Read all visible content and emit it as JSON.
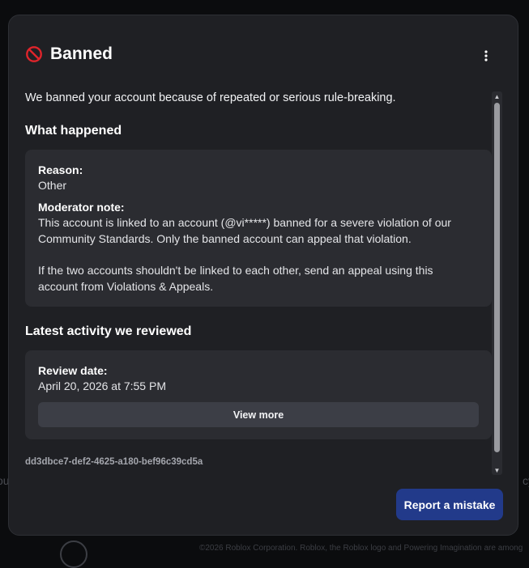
{
  "background": {
    "left_text": "ou",
    "right_text": "cy",
    "footer_text": "©2026 Roblox Corporation. Roblox, the Roblox logo and Powering Imagination are among"
  },
  "modal": {
    "title": "Banned",
    "icon": "ban-icon",
    "menu_icon": "more-vertical-icon",
    "intro": "We banned your account because of repeated or serious rule-breaking.",
    "what_happened": {
      "heading": "What happened",
      "reason_label": "Reason:",
      "reason_value": "Other",
      "note_label": "Moderator note:",
      "note_p1_line1": "This account is linked to an account (@vi*****) banned for a severe violation of our",
      "note_p1_line2": "Community Standards. Only the banned account can appeal that violation.",
      "note_p2_line1": "If the two accounts shouldn't be linked to each other, send an appeal using this",
      "note_p2_line2": "account from Violations & Appeals."
    },
    "latest_activity": {
      "heading": "Latest activity we reviewed",
      "review_date_label": "Review date:",
      "review_date_value": "April 20, 2026 at 7:55 PM",
      "view_more_label": "View more"
    },
    "report_id": "dd3dbce7-def2-4625-a180-bef96c39cd5a",
    "report_button_label": "Report a mistake"
  },
  "colors": {
    "modal_bg": "#1f2024",
    "card_bg": "#2b2c31",
    "accent": "#223a8a",
    "ban_red": "#e0242b"
  }
}
